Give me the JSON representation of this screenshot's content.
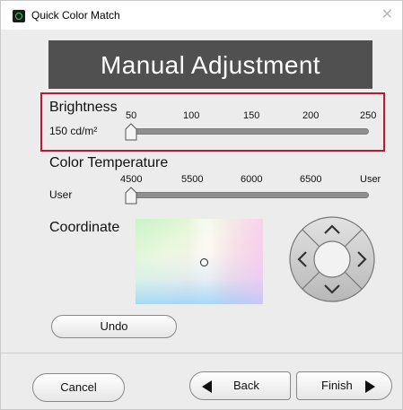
{
  "window": {
    "title": "Quick Color Match",
    "close_glyph": "✕"
  },
  "header": {
    "title": "Manual Adjustment"
  },
  "brightness": {
    "label": "Brightness",
    "value_text": "150 cd/m²",
    "ticks": [
      "50",
      "100",
      "150",
      "200",
      "250"
    ],
    "slider_fraction": 0
  },
  "color_temperature": {
    "label": "Color Temperature",
    "value_text": "User",
    "ticks": [
      "4500",
      "5500",
      "6000",
      "6500",
      "User"
    ],
    "slider_fraction": 0
  },
  "coordinate": {
    "label": "Coordinate"
  },
  "buttons": {
    "undo": "Undo",
    "cancel": "Cancel",
    "back": "Back",
    "finish": "Finish"
  },
  "colors": {
    "highlight_border": "#d0112b",
    "header_bg": "#505050",
    "app_icon_accent": "#2ad06a"
  }
}
